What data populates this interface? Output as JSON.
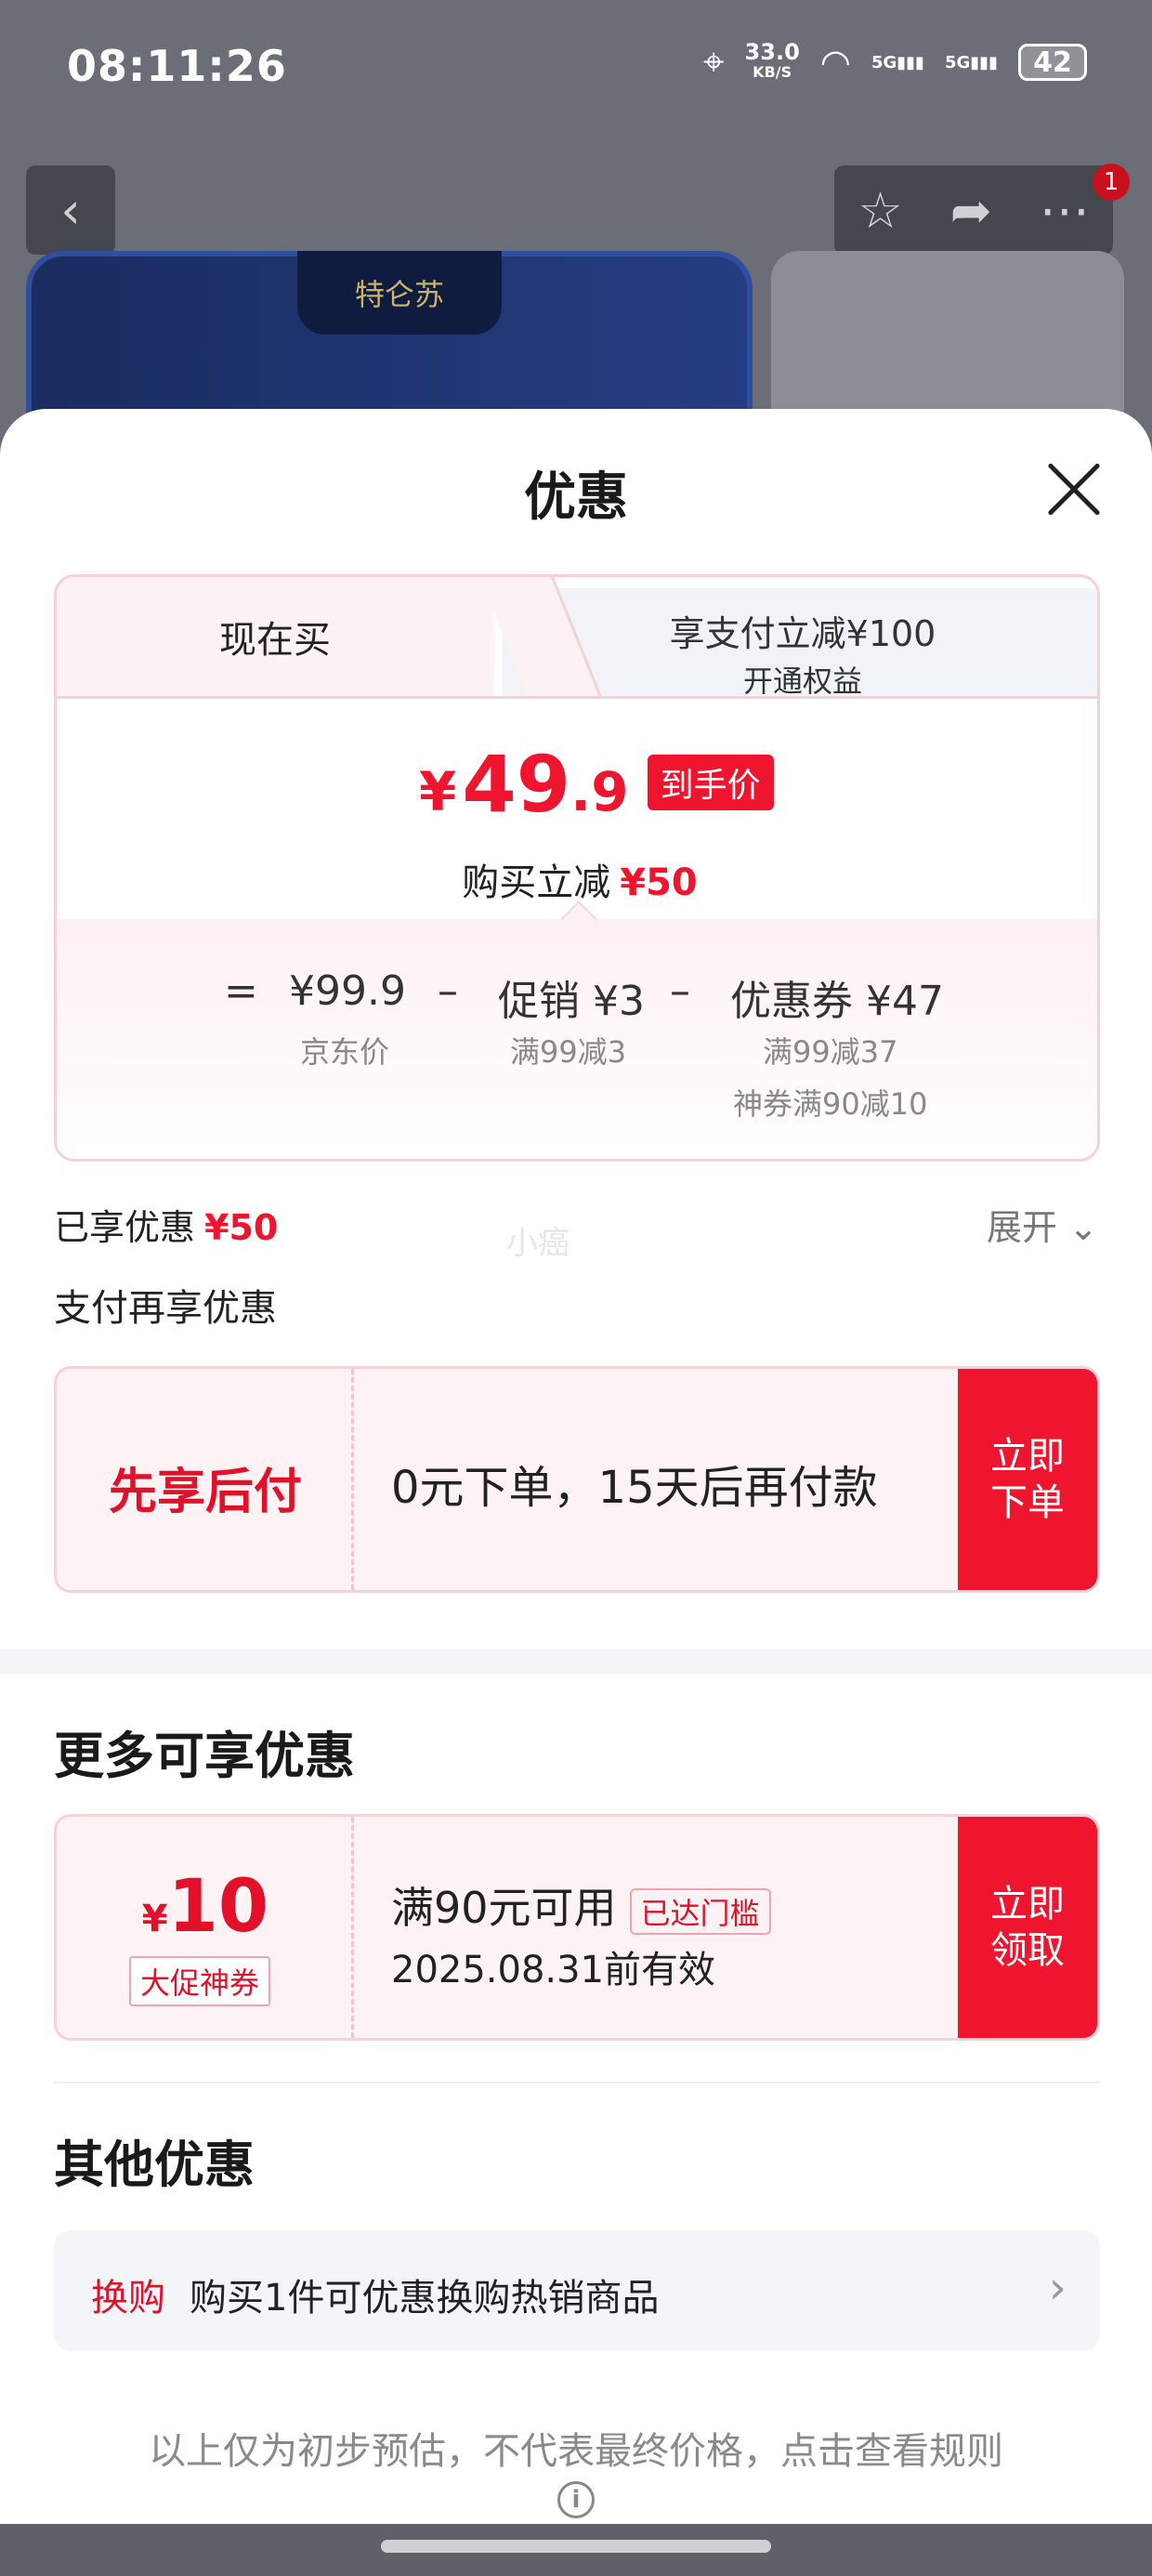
{
  "status_bar": {
    "time": "08:11:26",
    "net_speed": "33.0",
    "net_unit": "KB/S",
    "signal1": "5G",
    "signal2": "5G",
    "battery": "42"
  },
  "background": {
    "brand_logo": "特仑苏",
    "notification_count": "1"
  },
  "sheet": {
    "title": "优惠",
    "tabs": {
      "now_buy": "现在买",
      "pay_discount_line1": "享支付立减¥100",
      "pay_discount_line2": "开通权益"
    },
    "price": {
      "symbol": "¥",
      "integer": "49",
      "decimal": ".9",
      "tag": "到手价",
      "reduce_label": "购买立减",
      "reduce_value": "¥50"
    },
    "breakdown": {
      "equals": "=",
      "jd_price": "¥99.9",
      "jd_price_label": "京东价",
      "minus1": "–",
      "promo": "促销 ¥3",
      "promo_note": "满99减3",
      "minus2": "–",
      "coupon": "优惠券 ¥47",
      "coupon_note1": "满99减37",
      "coupon_note2": "神券满90减10"
    },
    "enjoyed_label": "已享优惠",
    "enjoyed_value": "¥50",
    "expand_label": "展开",
    "watermark": "小癌",
    "pay_more_label": "支付再享优惠",
    "pay_later": {
      "title": "先享后付",
      "desc": "0元下单，15天后再付款",
      "button": "立即下单"
    },
    "more_title": "更多可享优惠",
    "coupon": {
      "symbol": "¥",
      "amount": "10",
      "label": "大促神券",
      "condition": "满90元可用",
      "status_tag": "已达门槛",
      "expiry": "2025.08.31前有效",
      "button": "立即领取"
    },
    "other_title": "其他优惠",
    "other": {
      "tag": "换购",
      "text": "购买1件可优惠换购热销商品"
    },
    "footnote": "以上仅为初步预估，不代表最终价格，点击查看规则"
  },
  "icons": {
    "back": "chevron-left-icon",
    "favorite": "star-icon",
    "share": "share-icon",
    "more": "more-icon",
    "close": "close-icon",
    "expand": "chevron-down-icon",
    "arrow": "chevron-right-icon",
    "info": "info-icon"
  },
  "colors": {
    "accent_red": "#f0152e",
    "card_border": "#f7cfd6",
    "card_bg": "#fdf3f4"
  }
}
